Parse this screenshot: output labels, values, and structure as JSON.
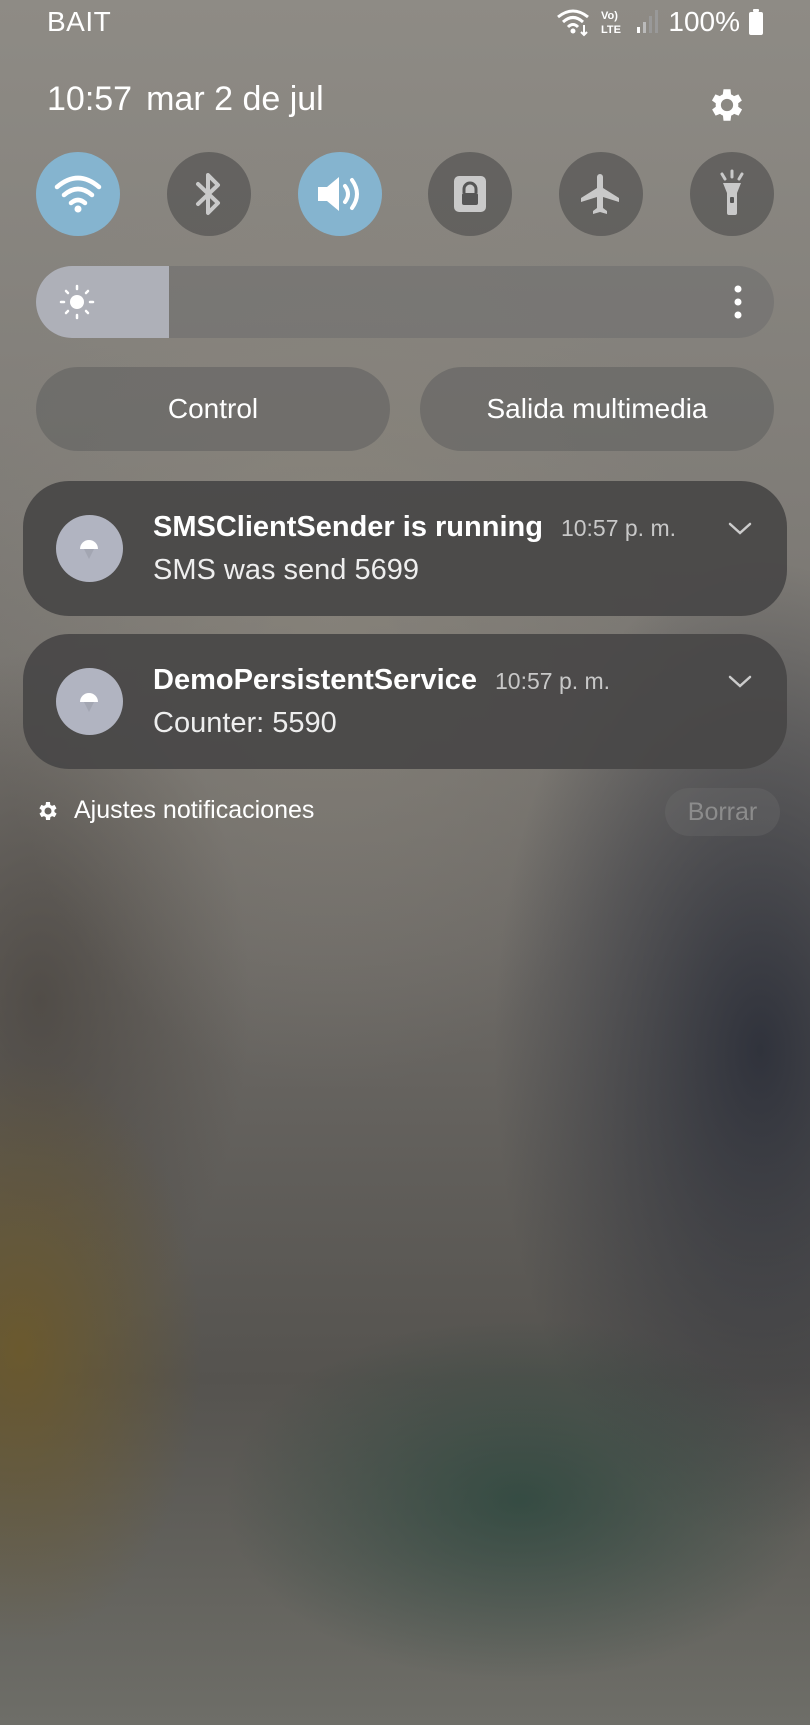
{
  "status_bar": {
    "carrier": "BAIT",
    "volte_label": "Vo) LTE",
    "battery": "100%"
  },
  "header": {
    "time": "10:57",
    "date": "mar 2 de jul"
  },
  "quick_tiles": [
    {
      "name": "wifi",
      "icon": "wifi-icon",
      "on": true
    },
    {
      "name": "bluetooth",
      "icon": "bluetooth-icon",
      "on": false
    },
    {
      "name": "sound",
      "icon": "volume-icon",
      "on": true
    },
    {
      "name": "rotation-lock",
      "icon": "lock-icon",
      "on": false
    },
    {
      "name": "airplane",
      "icon": "airplane-icon",
      "on": false
    },
    {
      "name": "flashlight",
      "icon": "flashlight-icon",
      "on": false
    }
  ],
  "brightness": {
    "level": 0.18
  },
  "buttons": {
    "control": "Control",
    "media_output": "Salida multimedia"
  },
  "notifications": [
    {
      "title": "SMSClientSender is running",
      "time": "10:57 p. m.",
      "body": "SMS was send 5699"
    },
    {
      "title": "DemoPersistentService",
      "time": "10:57 p. m.",
      "body": "Counter: 5590"
    }
  ],
  "footer": {
    "settings_label": "Ajustes notificaciones",
    "clear_label": "Borrar"
  },
  "colors": {
    "tile_on": "#85b4cf",
    "tile_off": "#464646",
    "notification_bg": "#484746"
  }
}
